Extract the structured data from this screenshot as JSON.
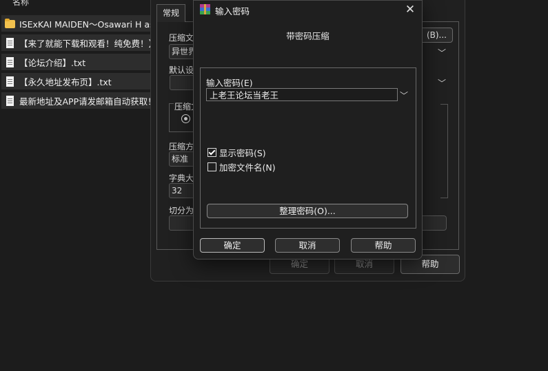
{
  "file_list": {
    "column_header": "名称",
    "items": [
      {
        "name": "ISExKAI MAIDEN～Osawari H as",
        "icon": "folder-icon"
      },
      {
        "name": "【来了就能下载和观看！纯免费！】",
        "icon": "document-icon"
      },
      {
        "name": "【论坛介绍】.txt",
        "icon": "document-icon"
      },
      {
        "name": "【永久地址发布页】.txt",
        "icon": "document-icon"
      },
      {
        "name": "最新地址及APP请发邮箱自动获取！",
        "icon": "document-icon"
      }
    ]
  },
  "archive_dialog": {
    "tab_general": "常规",
    "archive_name_label": "压缩文",
    "archive_name_value": "异世界",
    "browse_button": "(B)...",
    "default_profile_label": "默认设",
    "format_group_label": "压缩文",
    "method_label": "压缩方",
    "method_value": "标准",
    "dict_label": "字典大",
    "dict_value": "32",
    "split_label": "切分为",
    "ok_button": "确定",
    "cancel_button": "取消",
    "help_button": "帮助"
  },
  "password_dialog": {
    "title": "输入密码",
    "subtitle": "带密码压缩",
    "password_label": "输入密码(E)",
    "password_value": "上老王论坛当老王",
    "show_password_label": "显示密码(S)",
    "show_password_checked": true,
    "encrypt_names_label": "加密文件名(N)",
    "encrypt_names_checked": false,
    "organize_button": "整理密码(O)...",
    "ok_button": "确定",
    "cancel_button": "取消",
    "help_button": "帮助"
  },
  "colors": {
    "background": "#1c1c1c",
    "dialog": "#1f1f1f",
    "folder": "#f2c14e",
    "text": "#f0f0f0"
  }
}
